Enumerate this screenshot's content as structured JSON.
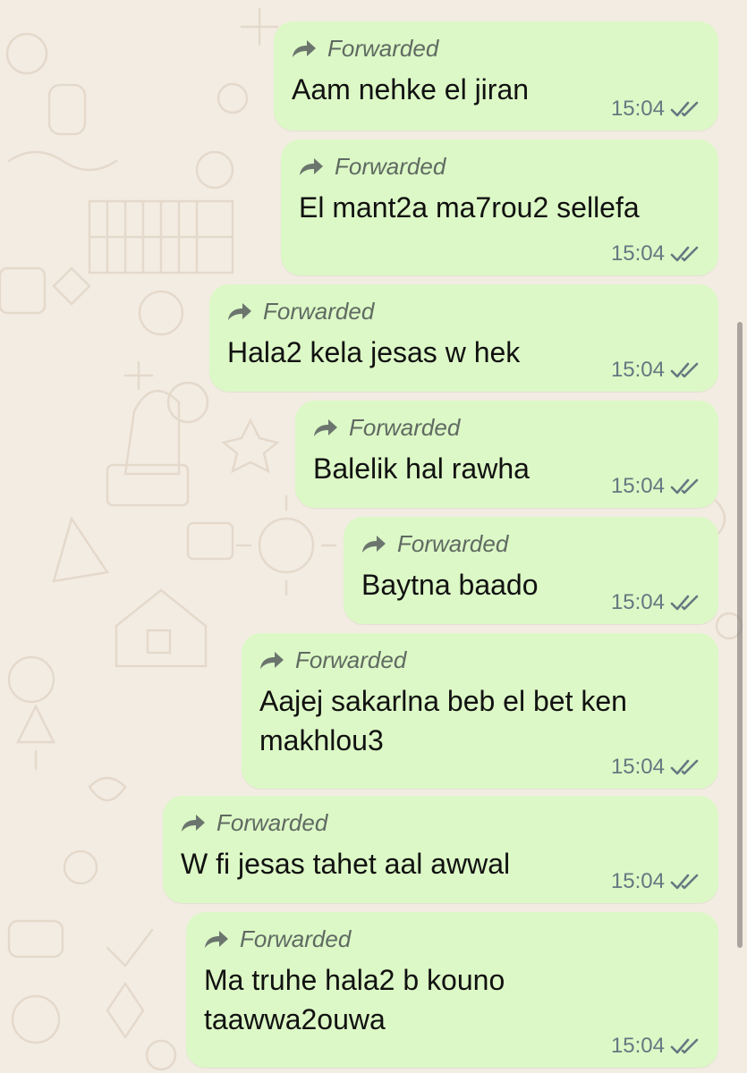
{
  "chat": {
    "forwarded_label": "Forwarded",
    "colors": {
      "bubble_outgoing": "#dcf8c6",
      "wallpaper": "#f3ece3",
      "meta_text": "#667781"
    },
    "messages": [
      {
        "text": "Aam nehke el jiran",
        "time": "15:04",
        "status": "read-ticks-icon"
      },
      {
        "text": "El mant2a ma7rou2 sellefa",
        "time": "15:04",
        "status": "read-ticks-icon"
      },
      {
        "text": "Hala2 kela jesas w hek",
        "time": "15:04",
        "status": "read-ticks-icon"
      },
      {
        "text": "Balelik hal rawha",
        "time": "15:04",
        "status": "read-ticks-icon"
      },
      {
        "text": "Baytna baado",
        "time": "15:04",
        "status": "read-ticks-icon"
      },
      {
        "text": "Aajej sakarlna beb el bet ken\nmakhlou3",
        "time": "15:04",
        "status": "read-ticks-icon"
      },
      {
        "text": "W fi jesas tahet aal awwal",
        "time": "15:04",
        "status": "read-ticks-icon"
      },
      {
        "text": "Ma truhe hala2 b kouno\ntaawwa2ouwa",
        "time": "15:04",
        "status": "read-ticks-icon"
      }
    ]
  }
}
